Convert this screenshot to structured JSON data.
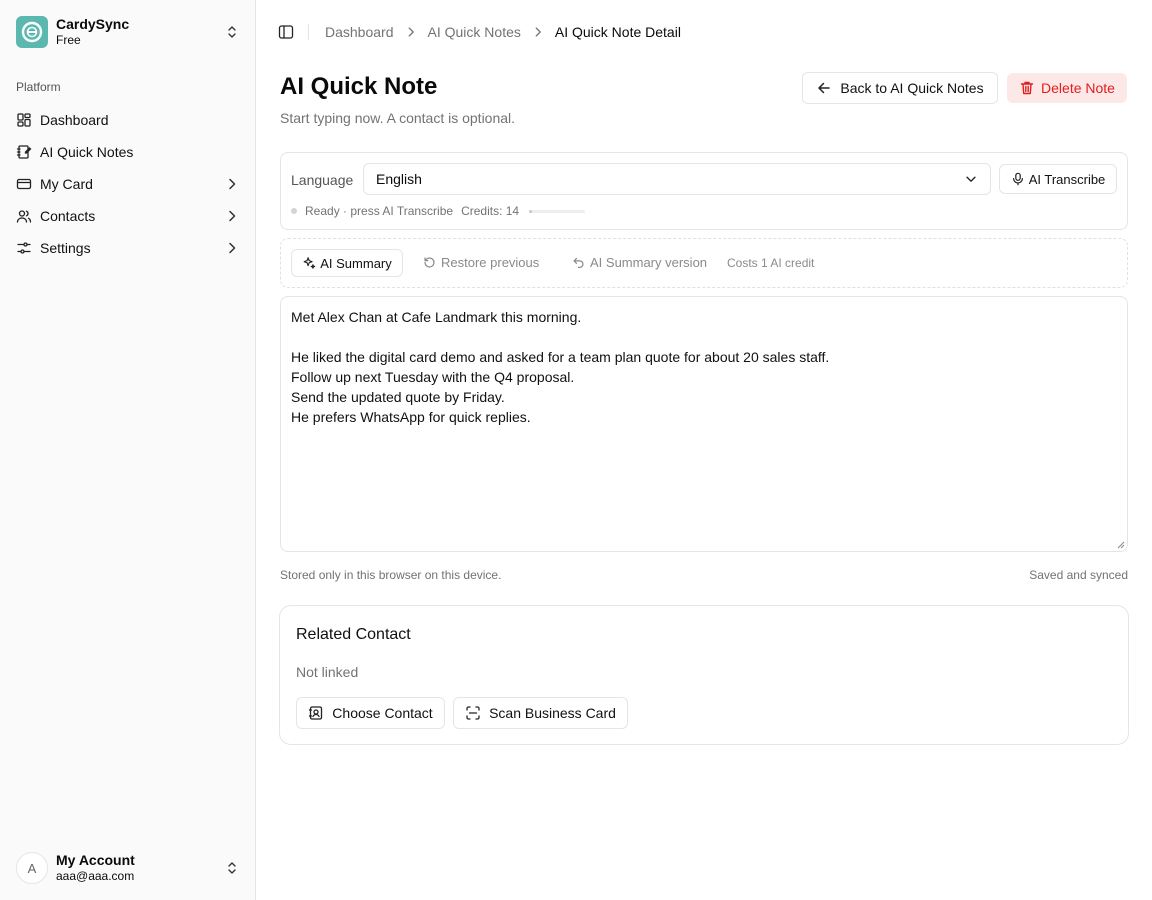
{
  "sidebar": {
    "team": {
      "name": "CardySync",
      "plan": "Free"
    },
    "group_label": "Platform",
    "items": [
      {
        "label": "Dashboard",
        "icon": "dashboard-icon"
      },
      {
        "label": "AI Quick Notes",
        "icon": "notebook-pen-icon"
      },
      {
        "label": "My Card",
        "icon": "credit-card-icon"
      },
      {
        "label": "Contacts",
        "icon": "users-icon"
      },
      {
        "label": "Settings",
        "icon": "settings-sliders-icon"
      }
    ],
    "user": {
      "initial": "A",
      "name": "My Account",
      "email": "aaa@aaa.com"
    }
  },
  "breadcrumb": [
    "Dashboard",
    "AI Quick Notes",
    "AI Quick Note Detail"
  ],
  "page": {
    "title": "AI Quick Note",
    "subtitle": "Start typing now. A contact is optional.",
    "back_label": "Back to AI Quick Notes",
    "delete_label": "Delete Note"
  },
  "transcribe": {
    "language_label": "Language",
    "language_value": "English",
    "button_label": "AI Transcribe",
    "status": "Ready · press AI Transcribe",
    "credits": "Credits: 14",
    "progress_fraction": 0.05
  },
  "summary": {
    "summary_label": "AI Summary",
    "restore_label": "Restore previous",
    "version_label": "AI Summary version",
    "cost": "Costs 1 AI credit"
  },
  "note": {
    "lines": [
      "Met Alex Chan at Cafe Landmark this morning.",
      "",
      "He liked the digital card demo and asked for a team plan quote for about 20 sales staff.",
      "Follow up next Tuesday with the Q4 proposal.",
      "Send the updated quote by Friday.",
      "He prefers WhatsApp for quick replies."
    ],
    "storage_note": "Stored only in this browser on this device.",
    "sync_status": "Saved and synced"
  },
  "related": {
    "title": "Related Contact",
    "status": "Not linked",
    "choose_label": "Choose Contact",
    "scan_label": "Scan Business Card"
  },
  "colors": {
    "brand": "#5bb8ae",
    "danger": "#e11d1d",
    "danger_bg": "#fde8e8"
  }
}
